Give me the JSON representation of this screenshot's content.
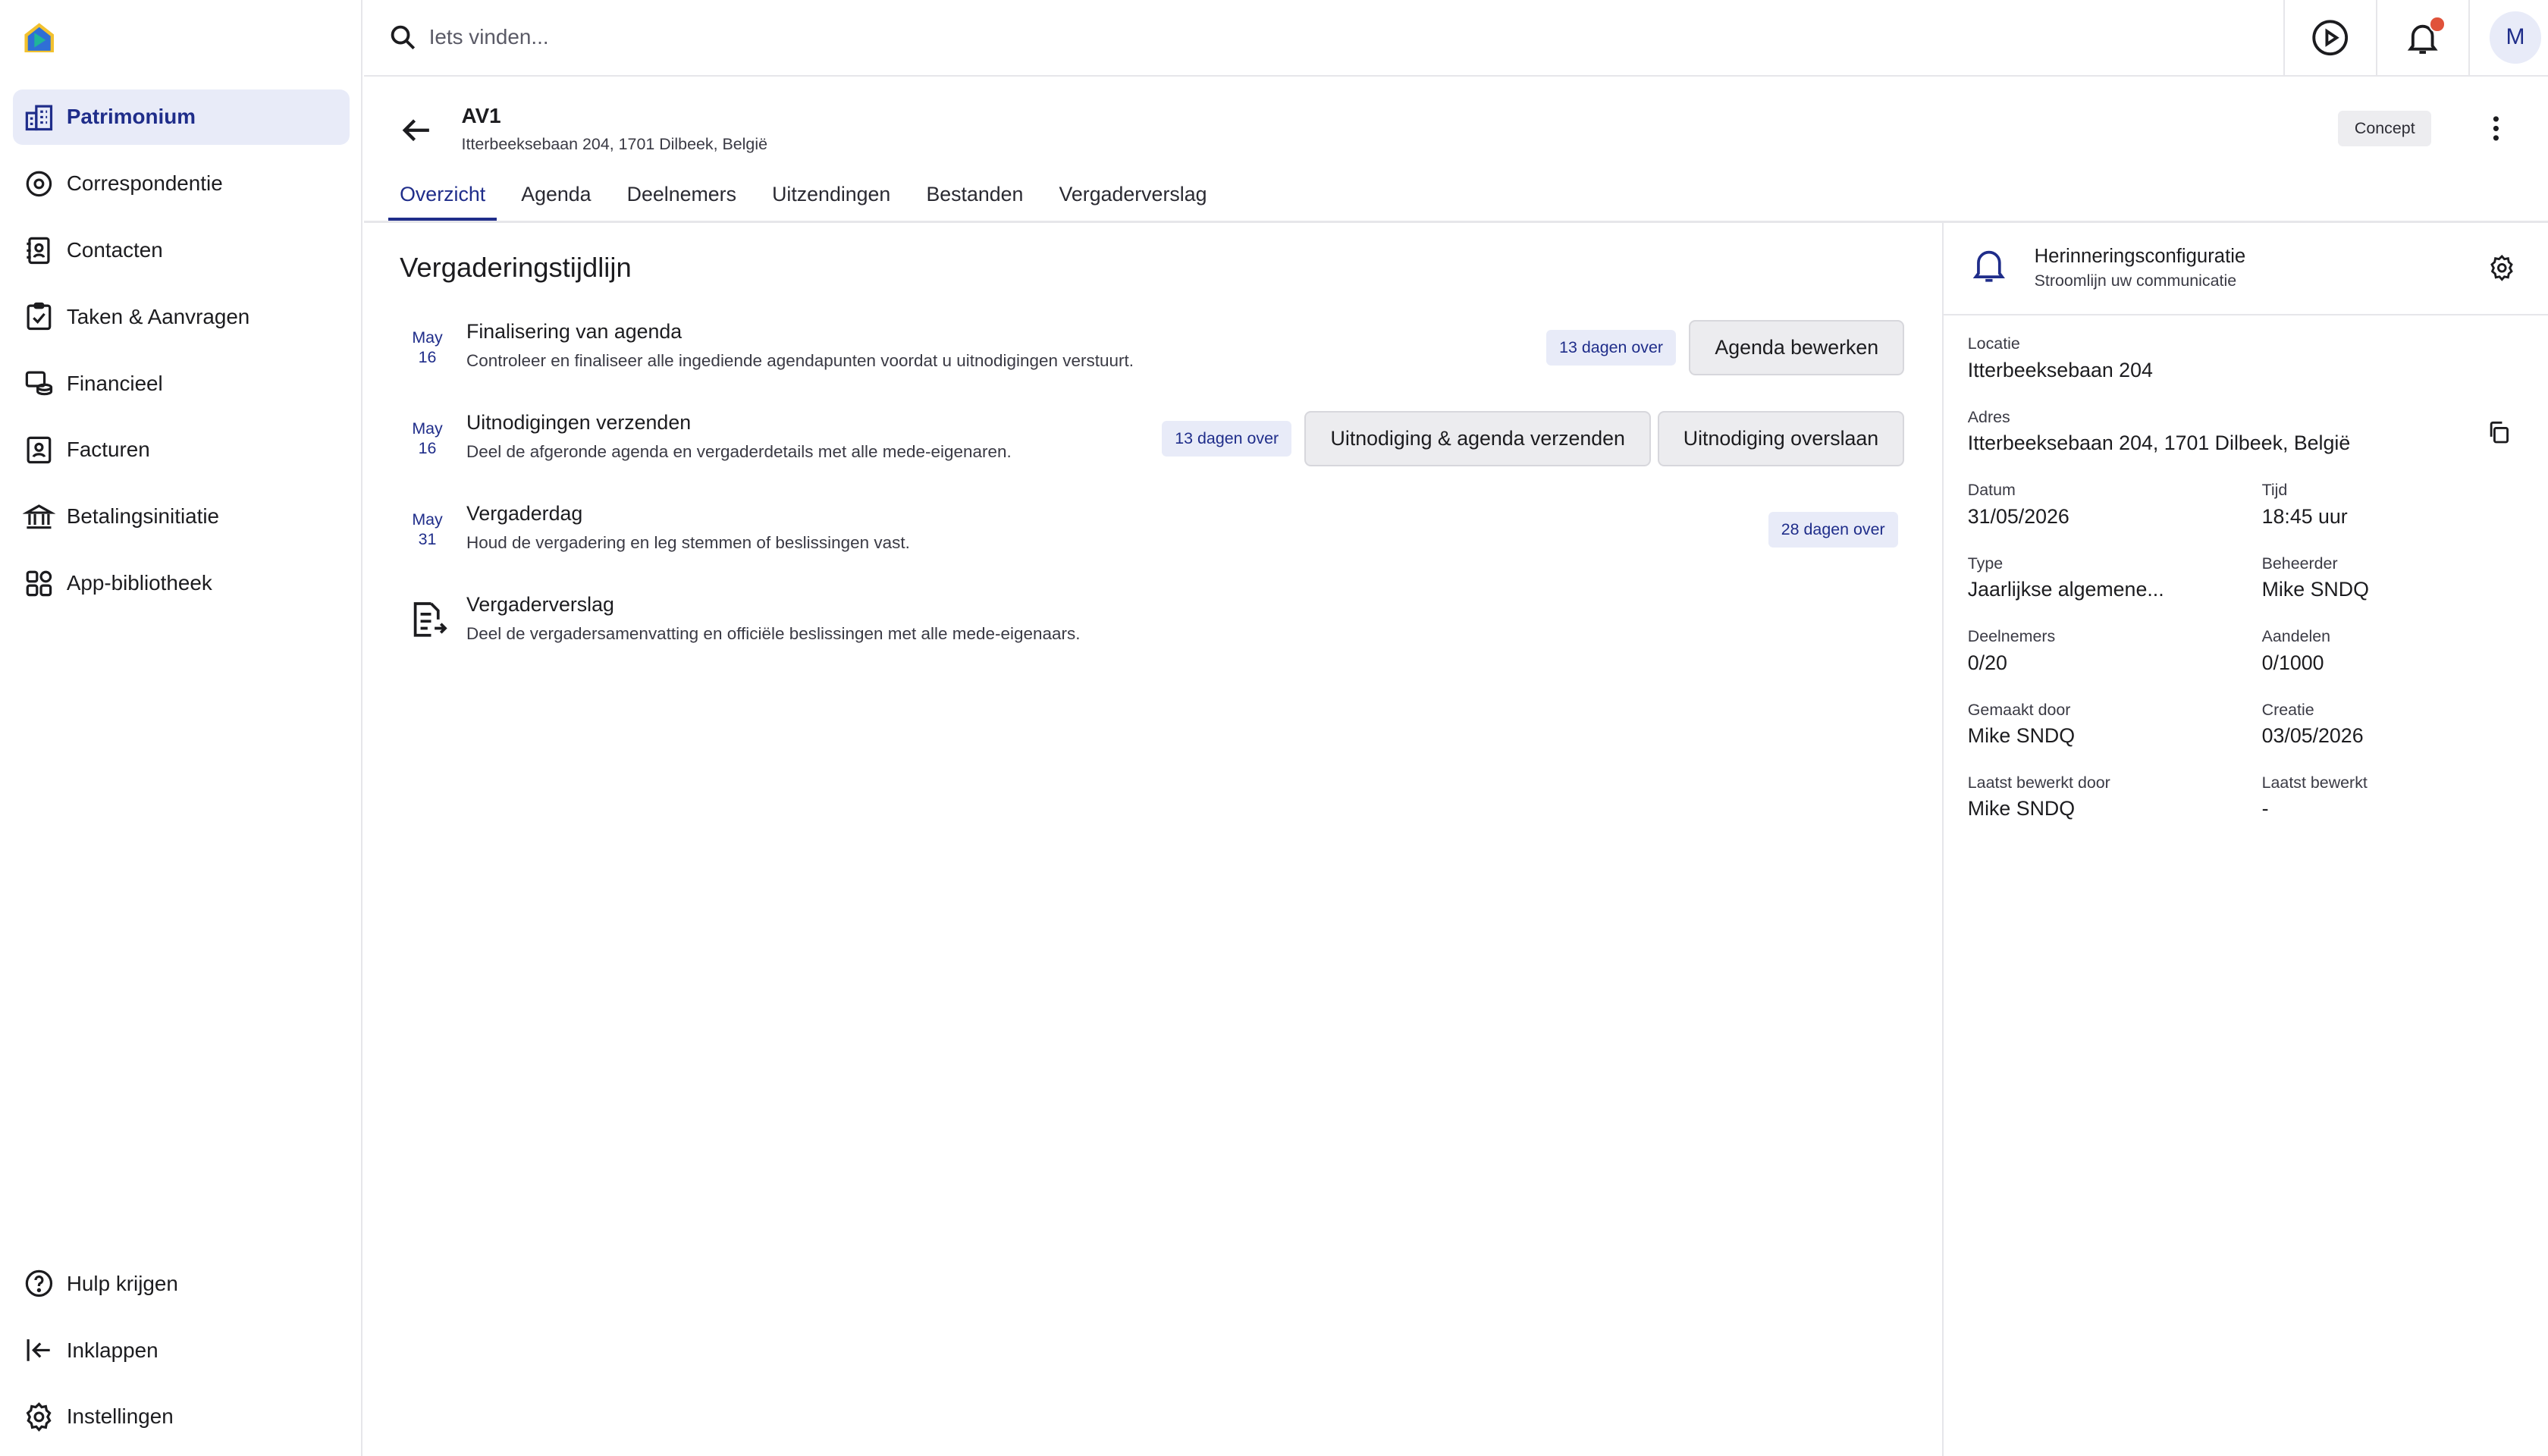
{
  "search": {
    "placeholder": "Iets vinden..."
  },
  "user": {
    "initial": "M"
  },
  "sidebar": {
    "items": [
      {
        "label": "Patrimonium",
        "icon": "buildings-icon",
        "active": true
      },
      {
        "label": "Correspondentie",
        "icon": "broadcast-icon"
      },
      {
        "label": "Contacten",
        "icon": "contacts-book-icon"
      },
      {
        "label": "Taken & Aanvragen",
        "icon": "clipboard-check-icon"
      },
      {
        "label": "Financieel",
        "icon": "coins-icon"
      },
      {
        "label": "Facturen",
        "icon": "invoice-person-icon"
      },
      {
        "label": "Betalingsinitiatie",
        "icon": "bank-icon"
      },
      {
        "label": "App-bibliotheek",
        "icon": "apps-grid-icon"
      }
    ],
    "bottom": [
      {
        "label": "Hulp krijgen",
        "icon": "help-circle-icon"
      },
      {
        "label": "Inklappen",
        "icon": "collapse-icon"
      },
      {
        "label": "Instellingen",
        "icon": "gear-icon"
      }
    ]
  },
  "header": {
    "title": "AV1",
    "subtitle": "Itterbeeksebaan 204, 1701 Dilbeek, België",
    "status": "Concept"
  },
  "tabs": [
    "Overzicht",
    "Agenda",
    "Deelnemers",
    "Uitzendingen",
    "Bestanden",
    "Vergaderverslag"
  ],
  "timeline": {
    "title": "Vergaderingstijdlijn",
    "items": [
      {
        "month": "May",
        "day": "16",
        "title": "Finalisering van agenda",
        "description": "Controleer en finaliseer alle ingediende agendapunten voordat u uitnodigingen verstuurt.",
        "badge": "13 dagen over",
        "buttons": [
          "Agenda bewerken"
        ]
      },
      {
        "month": "May",
        "day": "16",
        "title": "Uitnodigingen verzenden",
        "description": "Deel de afgeronde agenda en vergaderdetails met alle mede-eigenaren.",
        "badge": "13 dagen over",
        "buttons": [
          "Uitnodiging & agenda verzenden",
          "Uitnodiging overslaan"
        ]
      },
      {
        "month": "May",
        "day": "31",
        "title": "Vergaderdag",
        "description": "Houd de vergadering en leg stemmen of beslissingen vast.",
        "badge": "28 dagen over",
        "buttons": []
      },
      {
        "icon": "document-export-icon",
        "title": "Vergaderverslag",
        "description": "Deel de vergadersamenvatting en officiële beslissingen met alle mede-eigenaars."
      }
    ]
  },
  "panel": {
    "title": "Herinneringsconfiguratie",
    "subtitle": "Stroomlijn uw communicatie",
    "location": {
      "label": "Locatie",
      "value": "Itterbeeksebaan 204"
    },
    "address": {
      "label": "Adres",
      "value": "Itterbeeksebaan 204, 1701 Dilbeek, België"
    },
    "date": {
      "label": "Datum",
      "value": "31/05/2026"
    },
    "time": {
      "label": "Tijd",
      "value": "18:45 uur"
    },
    "type": {
      "label": "Type",
      "value": "Jaarlijkse algemene..."
    },
    "manager": {
      "label": "Beheerder",
      "value": "Mike SNDQ"
    },
    "participants": {
      "label": "Deelnemers",
      "value": "0/20"
    },
    "shares": {
      "label": "Aandelen",
      "value": "0/1000"
    },
    "created_by": {
      "label": "Gemaakt door",
      "value": "Mike SNDQ"
    },
    "created": {
      "label": "Creatie",
      "value": "03/05/2026"
    },
    "edited_by": {
      "label": "Laatst bewerkt door",
      "value": "Mike SNDQ"
    },
    "edited": {
      "label": "Laatst bewerkt",
      "value": "-"
    }
  },
  "colors": {
    "accent": "#1f2d8a",
    "accent_bg": "#e8ebf8",
    "notification": "#e0523a"
  }
}
